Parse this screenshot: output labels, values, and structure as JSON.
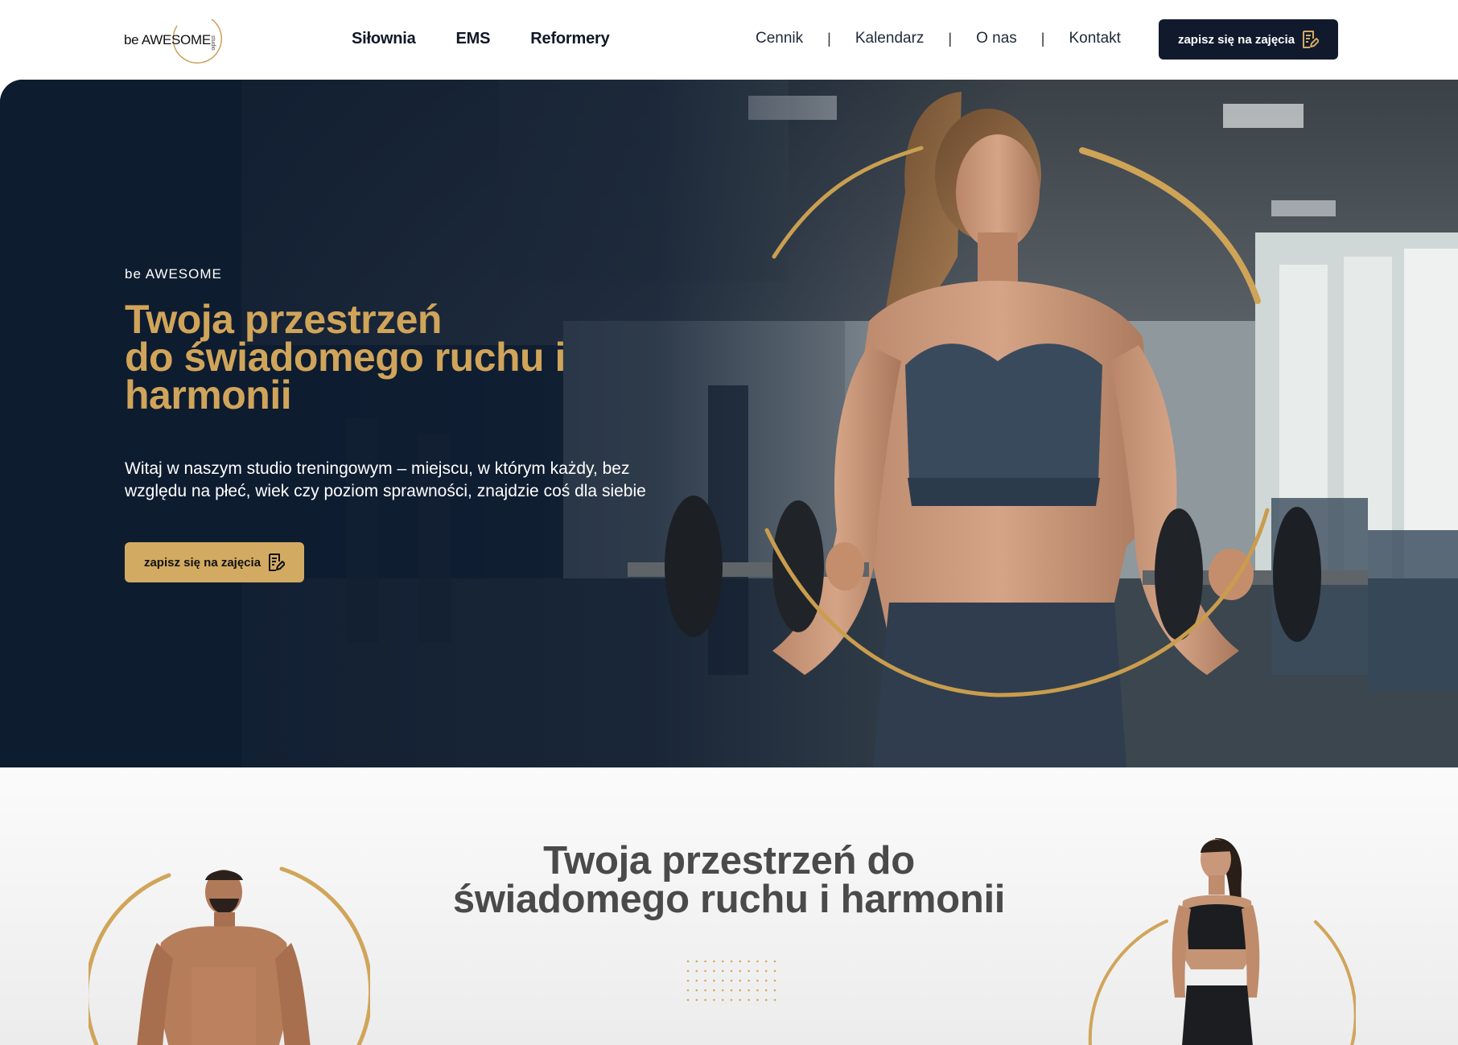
{
  "header": {
    "logo": {
      "prefix": "be",
      "name": "AWESOME",
      "sub": "studio"
    },
    "nav_main": [
      "Siłownia",
      "EMS",
      "Reformery"
    ],
    "nav_secondary": [
      "Cennik",
      "Kalendarz",
      "O nas",
      "Kontakt"
    ],
    "separator": "|",
    "cta_label": "zapisz się na zajęcia"
  },
  "hero": {
    "eyebrow": "be AWESOME",
    "title_lines": [
      "Twoja przestrzeń",
      "do świadomego ruchu i",
      "harmonii"
    ],
    "text": "Witaj w naszym studio treningowym – miejscu, w którym każdy, bez względu na płeć, wiek czy poziom sprawności, znajdzie coś dla siebie",
    "cta_label": "zapisz się na zajęcia"
  },
  "section2": {
    "title_lines": [
      "Twoja przestrzeń do",
      "świadomego ruchu i harmonii"
    ]
  },
  "colors": {
    "gold": "#d3aa62",
    "navy": "#111a2d",
    "title_gold": "#d0a55a",
    "heading_gray": "#4a4a4a"
  },
  "icons": {
    "cta": "edit-document-icon"
  }
}
